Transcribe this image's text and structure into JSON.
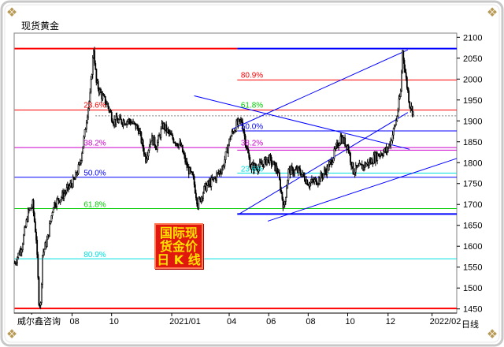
{
  "title": "现货黄金",
  "footer": "威尔鑫咨询",
  "period_label": "日线",
  "stamp": {
    "line1": "国际现",
    "line2": "货金价",
    "line3": "日 K 线"
  },
  "colors": {
    "red": "#ff0000",
    "blue": "#0000ff",
    "green": "#00cc00",
    "magenta": "#cc00cc",
    "cyan": "#00e0e0",
    "candle": "#000000"
  },
  "chart_data": {
    "type": "candlestick",
    "title": "现货黄金",
    "ylim": [
      1440,
      2110
    ],
    "y_ticks": [
      1450,
      1500,
      1550,
      1600,
      1650,
      1700,
      1750,
      1800,
      1850,
      1900,
      1950,
      2000,
      2050,
      2100
    ],
    "x_ticks": [
      {
        "label": "05",
        "i": 19
      },
      {
        "label": "08",
        "i": 64
      },
      {
        "label": "10",
        "i": 108
      },
      {
        "label": "2021/01",
        "i": 175
      },
      {
        "label": "04",
        "i": 239
      },
      {
        "label": "06",
        "i": 283
      },
      {
        "label": "08",
        "i": 327
      },
      {
        "label": "10",
        "i": 371
      },
      {
        "label": "12",
        "i": 416
      },
      {
        "label": "2022/02",
        "i": 465
      }
    ],
    "n_bars": 493,
    "price_path": [
      [
        0,
        1560
      ],
      [
        8,
        1600
      ],
      [
        15,
        1680
      ],
      [
        20,
        1700
      ],
      [
        24,
        1620
      ],
      [
        27,
        1470
      ],
      [
        29,
        1460
      ],
      [
        31,
        1580
      ],
      [
        37,
        1620
      ],
      [
        43,
        1700
      ],
      [
        53,
        1720
      ],
      [
        60,
        1740
      ],
      [
        67,
        1760
      ],
      [
        73,
        1800
      ],
      [
        78,
        1870
      ],
      [
        81,
        1920
      ],
      [
        84,
        1960
      ],
      [
        86,
        2020
      ],
      [
        88,
        2073
      ],
      [
        91,
        1990
      ],
      [
        97,
        1960
      ],
      [
        103,
        1940
      ],
      [
        110,
        1900
      ],
      [
        120,
        1900
      ],
      [
        128,
        1900
      ],
      [
        138,
        1880
      ],
      [
        146,
        1810
      ],
      [
        152,
        1860
      ],
      [
        158,
        1840
      ],
      [
        165,
        1890
      ],
      [
        175,
        1860
      ],
      [
        185,
        1840
      ],
      [
        192,
        1790
      ],
      [
        199,
        1760
      ],
      [
        204,
        1700
      ],
      [
        212,
        1740
      ],
      [
        222,
        1760
      ],
      [
        232,
        1790
      ],
      [
        240,
        1860
      ],
      [
        247,
        1890
      ],
      [
        253,
        1900
      ],
      [
        258,
        1840
      ],
      [
        263,
        1790
      ],
      [
        272,
        1790
      ],
      [
        283,
        1810
      ],
      [
        293,
        1780
      ],
      [
        300,
        1690
      ],
      [
        305,
        1780
      ],
      [
        317,
        1780
      ],
      [
        328,
        1750
      ],
      [
        339,
        1760
      ],
      [
        350,
        1790
      ],
      [
        363,
        1860
      ],
      [
        371,
        1840
      ],
      [
        377,
        1780
      ],
      [
        386,
        1790
      ],
      [
        395,
        1800
      ],
      [
        405,
        1820
      ],
      [
        415,
        1830
      ],
      [
        420,
        1860
      ],
      [
        425,
        1900
      ],
      [
        430,
        1970
      ],
      [
        432,
        2067
      ],
      [
        436,
        2000
      ],
      [
        440,
        1940
      ],
      [
        444,
        1920
      ]
    ],
    "horizontal_levels": [
      {
        "value": 2073,
        "color": "#ff0000",
        "x0": 0,
        "x1": 248,
        "width": 2
      },
      {
        "value": 2073,
        "color": "#0000ff",
        "x0": 248,
        "x1": 493,
        "width": 2
      },
      {
        "value": 1451,
        "color": "#ff0000",
        "x0": 0,
        "x1": 493,
        "width": 2
      },
      {
        "value": 1677,
        "color": "#0000ff",
        "x0": 248,
        "x1": 493,
        "width": 2
      },
      {
        "value": 1998,
        "color": "#ff0000",
        "x0": 248,
        "x1": 493,
        "width": 1
      },
      {
        "value": 1926,
        "color": "#ff0000",
        "x0": 0,
        "x1": 493,
        "width": 1
      },
      {
        "value": 1912,
        "color": "#808080",
        "x0": 90,
        "x1": 493,
        "width": 1,
        "dashed": true
      },
      {
        "value": 1876,
        "color": "#0000ff",
        "x0": 248,
        "x1": 493,
        "width": 1
      },
      {
        "value": 1836,
        "color": "#cc00cc",
        "x0": 0,
        "x1": 493,
        "width": 1
      },
      {
        "value": 1830,
        "color": "#cc00cc",
        "x0": 248,
        "x1": 493,
        "width": 1
      },
      {
        "value": 1765,
        "color": "#0000ff",
        "x0": 0,
        "x1": 493,
        "width": 1
      },
      {
        "value": 1775,
        "color": "#00e0e0",
        "x0": 248,
        "x1": 493,
        "width": 1
      },
      {
        "value": 1690,
        "color": "#00cc00",
        "x0": 0,
        "x1": 493,
        "width": 1
      },
      {
        "value": 1570,
        "color": "#00e0e0",
        "x0": 0,
        "x1": 493,
        "width": 1
      }
    ],
    "trend_lines": [
      {
        "from": [
          242,
          1880
        ],
        "to": [
          438,
          2070
        ],
        "color": "#0000ff"
      },
      {
        "from": [
          250,
          1677
        ],
        "to": [
          438,
          1920
        ],
        "color": "#0000ff"
      },
      {
        "from": [
          282,
          1660
        ],
        "to": [
          493,
          1810
        ],
        "color": "#0000ff"
      },
      {
        "from": [
          200,
          1960
        ],
        "to": [
          440,
          1832
        ],
        "color": "#0000ff"
      }
    ],
    "annotations": [
      {
        "text": "80.9%",
        "i": 252,
        "value": 2003,
        "color": "#ff0000"
      },
      {
        "text": "23.6%",
        "i": 77,
        "value": 1932,
        "color": "#ff0000"
      },
      {
        "text": "61.8%",
        "i": 252,
        "value": 1932,
        "color": "#00cc00"
      },
      {
        "text": "50.0%",
        "i": 252,
        "value": 1881,
        "color": "#0000ff"
      },
      {
        "text": "38.2%",
        "i": 77,
        "value": 1841,
        "color": "#cc00cc"
      },
      {
        "text": "38.2%",
        "i": 252,
        "value": 1841,
        "color": "#cc00cc"
      },
      {
        "text": "50.0%",
        "i": 77,
        "value": 1769,
        "color": "#0000ff"
      },
      {
        "text": "23.6%",
        "i": 252,
        "value": 1779,
        "color": "#00e0e0"
      },
      {
        "text": "61.8%",
        "i": 77,
        "value": 1694,
        "color": "#00cc00"
      },
      {
        "text": "80.9%",
        "i": 77,
        "value": 1574,
        "color": "#00e0e0"
      }
    ]
  }
}
